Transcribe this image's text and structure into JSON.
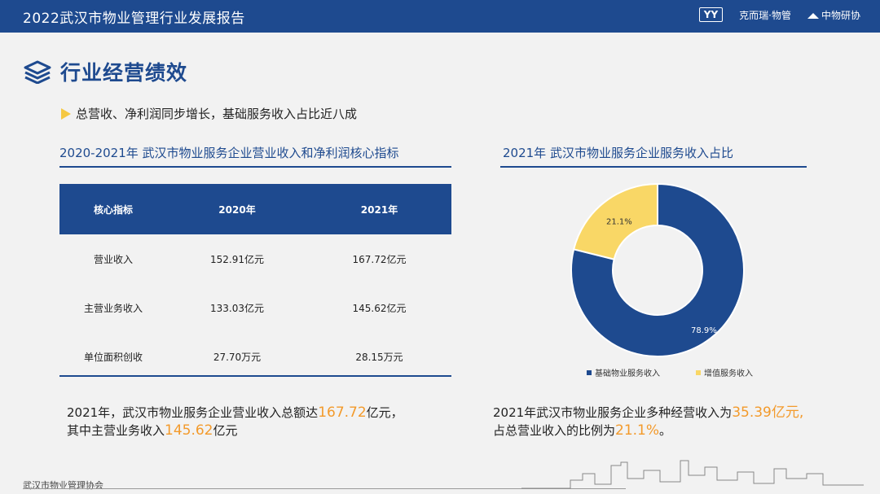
{
  "header": {
    "title": "2022武汉市物业管理行业发展报告",
    "logos": [
      "YY",
      "克而瑞·物管",
      "中物研协"
    ]
  },
  "section": {
    "title": "行业经营绩效"
  },
  "bullet": "总营收、净利润同步增长，基础服务收入占比近八成",
  "left_panel": {
    "title": "2020-2021年 武汉市物业服务企业营业收入和净利润核心指标",
    "columns": [
      "核心指标",
      "2020年",
      "2021年"
    ],
    "rows": [
      [
        "营业收入",
        "152.91亿元",
        "167.72亿元"
      ],
      [
        "主营业务收入",
        "133.03亿元",
        "145.62亿元"
      ],
      [
        "单位面积创收",
        "27.70万元",
        "28.15万元"
      ]
    ],
    "summary": {
      "l1_a": "2021年，武汉市物业服务企业营业收入总额达",
      "l1_hl": "167.72",
      "l1_b": "亿元，",
      "l2_a": "其中主营业务收入",
      "l2_hl": "145.62",
      "l2_b": "亿元"
    }
  },
  "right_panel": {
    "title": "2021年 武汉市物业服务企业服务收入占比",
    "summary": {
      "l1_a": "2021年武汉市物业服务企业多种经营收入为",
      "l1_hl": "35.39亿元,",
      "l2_a": "占总营业收入的比例为",
      "l2_hl": "21.1%",
      "l2_b": "。"
    }
  },
  "chart_data": {
    "type": "pie",
    "donut": true,
    "categories": [
      "基础物业服务收入",
      "增值服务收入"
    ],
    "values": [
      78.9,
      21.1
    ],
    "labels": [
      "78.9%",
      "21.1%"
    ],
    "colors": [
      "#1e4a8f",
      "#f9d766"
    ],
    "legend": "bottom"
  },
  "footer": {
    "org": "武汉市物业管理协会"
  }
}
